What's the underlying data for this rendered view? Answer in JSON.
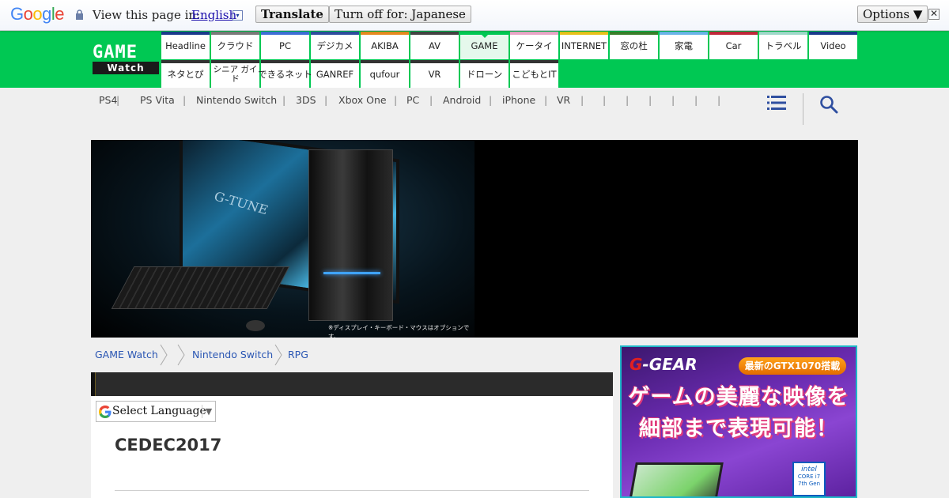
{
  "translate_bar": {
    "logo": "Google",
    "view_label": "View this page in:",
    "language": "English",
    "dropdown_arrow": "▾",
    "translate_button": "Translate",
    "turn_off_button": "Turn off for: Japanese",
    "options_button": "Options ▼",
    "close_glyph": "✕",
    "icons": [
      "lock-icon",
      "close-icon"
    ]
  },
  "site": {
    "logo_top": "GAME",
    "logo_bottom": "Watch",
    "accent_color": "#00c853"
  },
  "nav": {
    "row1": [
      {
        "label": "Headline",
        "color": "#1a3b8c"
      },
      {
        "label": "クラウド",
        "color": "#7a7a7a"
      },
      {
        "label": "PC",
        "color": "#3d6fd6"
      },
      {
        "label": "デジカメ",
        "color": "#2e4e9e"
      },
      {
        "label": "AKIBA",
        "color": "#e58a1f"
      },
      {
        "label": "AV",
        "color": "#444444"
      },
      {
        "label": "GAME",
        "color": "#00c853",
        "active": true
      },
      {
        "label": "ケータイ",
        "color": "#e8a6c6"
      },
      {
        "label": "INTERNET",
        "color": "#e6c21a"
      },
      {
        "label": "窓の杜",
        "color": "#3a7f2b"
      },
      {
        "label": "家電",
        "color": "#6ab5e8"
      },
      {
        "label": "Car",
        "color": "#c0283a"
      },
      {
        "label": "トラベル",
        "color": "#9ed9c9"
      },
      {
        "label": "Video",
        "color": "#1a3b8c"
      }
    ],
    "row2": [
      {
        "label": "ネタとぴ"
      },
      {
        "label": "シニア ガイド",
        "two_line": true
      },
      {
        "label": "できるネット"
      },
      {
        "label": "GANREF"
      },
      {
        "label": "qufour"
      },
      {
        "label": "VR"
      },
      {
        "label": "ドローン"
      },
      {
        "label": "こどもとIT"
      }
    ]
  },
  "subnav": {
    "items": [
      "PS4",
      "PS Vita",
      "Nintendo Switch",
      "3DS",
      "Xbox One",
      "PC",
      "Android",
      "iPhone",
      "VR",
      "",
      "",
      "",
      "",
      "",
      ""
    ],
    "separator": "|",
    "icons": [
      "menu-icon",
      "search-icon"
    ]
  },
  "banner": {
    "note": "※ディスプレイ・キーボード・マウスはオプションです。",
    "screen_text": "G-TUNE"
  },
  "breadcrumb": {
    "items": [
      "GAME Watch",
      "",
      "Nintendo Switch",
      "RPG"
    ]
  },
  "article": {
    "language_selector": "Select Language",
    "language_selector_arrow": "▼",
    "title": "CEDEC2017"
  },
  "ad": {
    "brand_g": "G",
    "brand_rest": "-GEAR",
    "badge": "最新のGTX1070搭載",
    "copy_line1": "ゲームの美麗な映像を",
    "copy_line2": "細部まで表現可能！",
    "intel_brand": "intel",
    "intel_model": "CORE i7",
    "intel_gen": "7th Gen"
  }
}
